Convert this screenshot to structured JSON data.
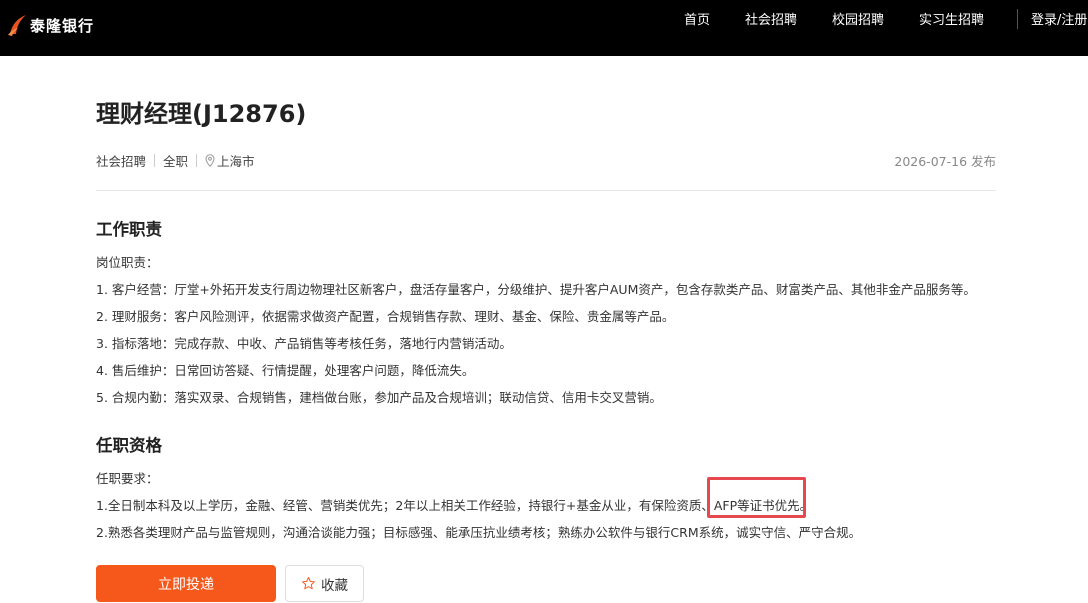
{
  "brand": {
    "name": "泰隆银行",
    "accent": "#f5581a",
    "logo_color": "#e8531f"
  },
  "nav": {
    "items": [
      "首页",
      "社会招聘",
      "校园招聘",
      "实习生招聘"
    ],
    "login": "登录/注册"
  },
  "job": {
    "title": "理财经理(J12876)",
    "type": "社会招聘",
    "employment": "全职",
    "location": "上海市",
    "published": "2026-07-16 发布"
  },
  "duties": {
    "heading": "工作职责",
    "intro": "岗位职责：",
    "items": [
      "1. 客户经营：厅堂+外拓开发支行周边物理社区新客户，盘活存量客户，分级维护、提升客户AUM资产，包含存款类产品、财富类产品、其他非金产品服务等。",
      "2. 理财服务：客户风险测评，依据需求做资产配置，合规销售存款、理财、基金、保险、贵金属等产品。",
      "3. 指标落地：完成存款、中收、产品销售等考核任务，落地行内营销活动。",
      "4. 售后维护：日常回访答疑、行情提醒，处理客户问题，降低流失。",
      "5. 合规内勤：落实双录、合规销售，建档做台账，参加产品及合规培训；联动信贷、信用卡交叉营销。"
    ]
  },
  "requirements": {
    "heading": "任职资格",
    "intro": "任职要求：",
    "items": [
      "1.全日制本科及以上学历，金融、经管、营销类优先；2年以上相关工作经验，持银行+基金从业，有保险资质、AFP等证书优先。",
      "2.熟悉各类理财产品与监管规则，沟通洽谈能力强；目标感强、能承压抗业绩考核；熟练办公软件与银行CRM系统，诚实守信、严守合规。"
    ]
  },
  "actions": {
    "apply": "立即投递",
    "favorite": "收藏"
  },
  "highlight_color": "#e5484d"
}
